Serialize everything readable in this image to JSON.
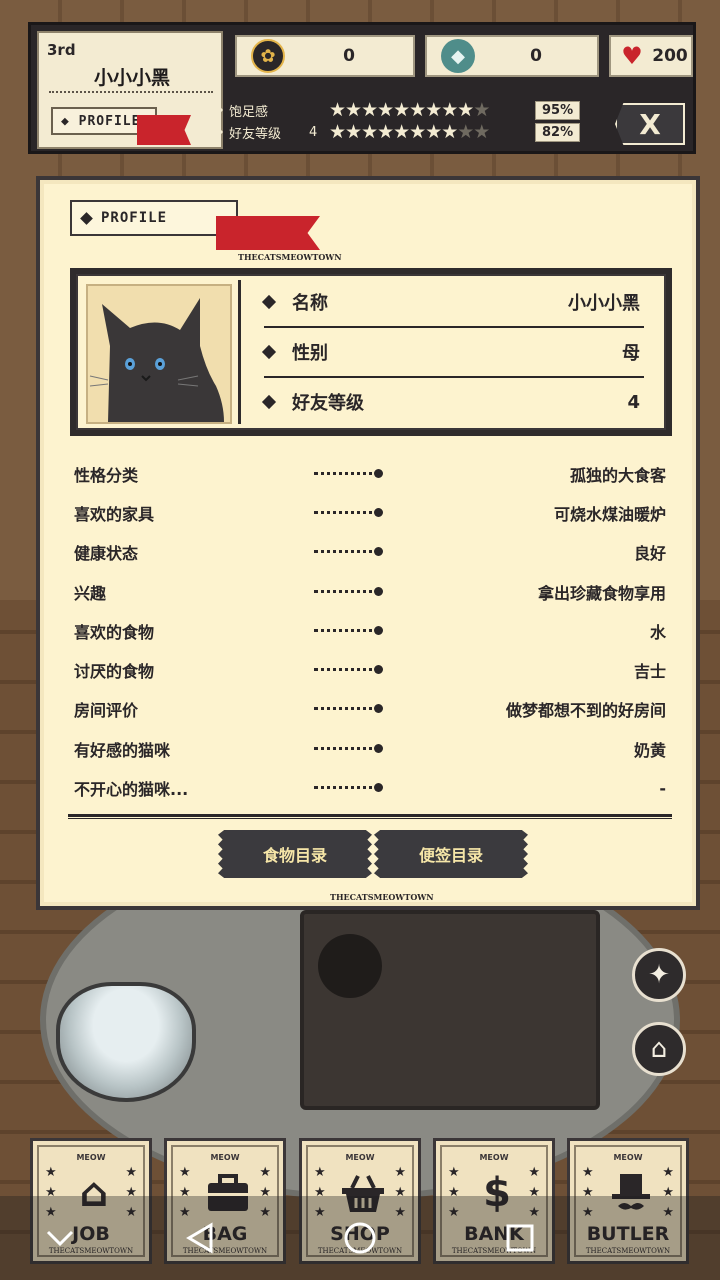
{
  "hud": {
    "rank": "3rd",
    "cat_name": "小小小黑",
    "profile_tag": "PROFILE",
    "resources": [
      {
        "icon": "paw-icon",
        "value": "0"
      },
      {
        "icon": "diamond-icon",
        "value": "0"
      },
      {
        "icon": "heart-icon",
        "value": "200"
      }
    ],
    "satiety": {
      "label": "饱足感",
      "percent": "95%",
      "stars_full": 9.5,
      "stars_total": 10
    },
    "friendship": {
      "label": "好友等级",
      "level": "4",
      "percent": "82%",
      "stars_full": 8.2,
      "stars_total": 10
    },
    "close_label": "X"
  },
  "panel": {
    "tag": "PROFILE",
    "brand": "THECATSMEOWTOWN",
    "info": [
      {
        "label": "名称",
        "value": "小小小黑"
      },
      {
        "label": "性别",
        "value": "母"
      },
      {
        "label": "好友等级",
        "value": "4"
      }
    ],
    "attributes": [
      {
        "label": "性格分类",
        "value": "孤独的大食客"
      },
      {
        "label": "喜欢的家具",
        "value": "可烧水煤油暖炉"
      },
      {
        "label": "健康状态",
        "value": "良好"
      },
      {
        "label": "兴趣",
        "value": "拿出珍藏食物享用"
      },
      {
        "label": "喜欢的食物",
        "value": "水"
      },
      {
        "label": "讨厌的食物",
        "value": "吉士"
      },
      {
        "label": "房间评价",
        "value": "做梦都想不到的好房间"
      },
      {
        "label": "有好感的猫咪",
        "value": "奶黄"
      },
      {
        "label": "不开心的猫咪...",
        "value": "-"
      }
    ],
    "buttons": {
      "food_catalog": "食物目录",
      "note_catalog": "便签目录"
    },
    "brand_bottom": "THECATSMEOWTOWN"
  },
  "menu": [
    {
      "label": "JOB",
      "icon": "house-icon",
      "meow": "MEOW",
      "brand": "THECATSMEOWTOWN"
    },
    {
      "label": "BAG",
      "icon": "briefcase-icon",
      "meow": "MEOW",
      "brand": "THECATSMEOWTOWN"
    },
    {
      "label": "SHOP",
      "icon": "basket-icon",
      "meow": "MEOW",
      "brand": "THECATSMEOWTOWN"
    },
    {
      "label": "BANK",
      "icon": "dollar-icon",
      "meow": "MEOW",
      "brand": "THECATSMEOWTOWN"
    },
    {
      "label": "BUTLER",
      "icon": "top-hat-icon",
      "meow": "MEOW",
      "brand": "THECATSMEOWTOWN"
    }
  ],
  "colors": {
    "panel_bg": "#fdf3cf",
    "dark": "#2a2628",
    "ribbon_red": "#c9242c",
    "button_text": "#f6e6a8"
  }
}
